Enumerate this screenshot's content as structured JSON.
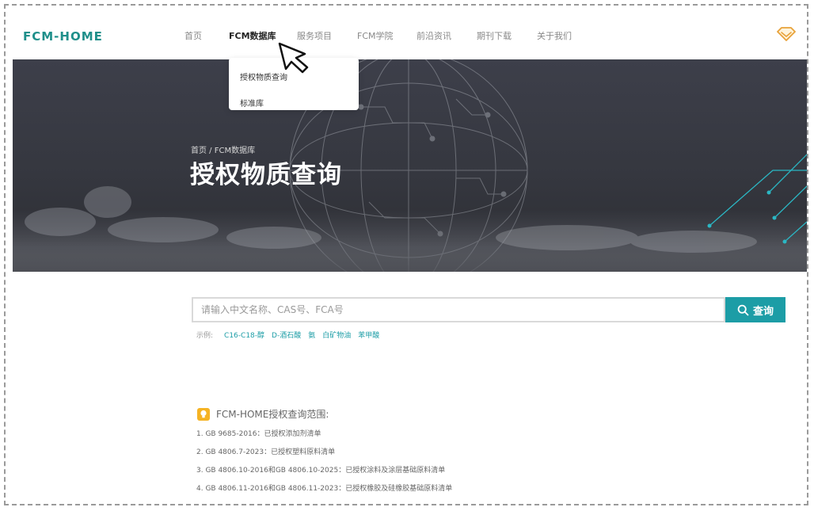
{
  "header": {
    "logo": "FCM-HOME",
    "nav": [
      {
        "label": "首页"
      },
      {
        "label": "FCM数据库",
        "active": true
      },
      {
        "label": "服务项目"
      },
      {
        "label": "FCM学院"
      },
      {
        "label": "前沿资讯"
      },
      {
        "label": "期刊下载"
      },
      {
        "label": "关于我们"
      }
    ],
    "icon": "diamond-icon",
    "accent_color": "#e8a23a"
  },
  "dropdown": {
    "items": [
      {
        "label": "授权物质查询"
      },
      {
        "label": "标准库"
      }
    ]
  },
  "hero": {
    "breadcrumb": "首页 / FCM数据库",
    "title": "授权物质查询"
  },
  "search": {
    "placeholder": "请输入中文名称、CAS号、FCA号",
    "value": "",
    "button_label": "查询",
    "button_color": "#1c9da6",
    "examples_label": "示例:",
    "examples": [
      "C16-C18-醇",
      "D-酒石酸",
      "氨",
      "白矿物油",
      "苯甲酸"
    ]
  },
  "scope": {
    "title": "FCM-HOME授权查询范围:",
    "items": [
      "1. GB 9685-2016：已授权添加剂清单",
      "2. GB 4806.7-2023：已授权塑料原料清单",
      "3. GB 4806.10-2016和GB 4806.10-2025：已授权涂料及涂层基础原料清单",
      "4. GB 4806.11-2016和GB 4806.11-2023：已授权橡胶及硅橡胶基础原料清单"
    ]
  }
}
